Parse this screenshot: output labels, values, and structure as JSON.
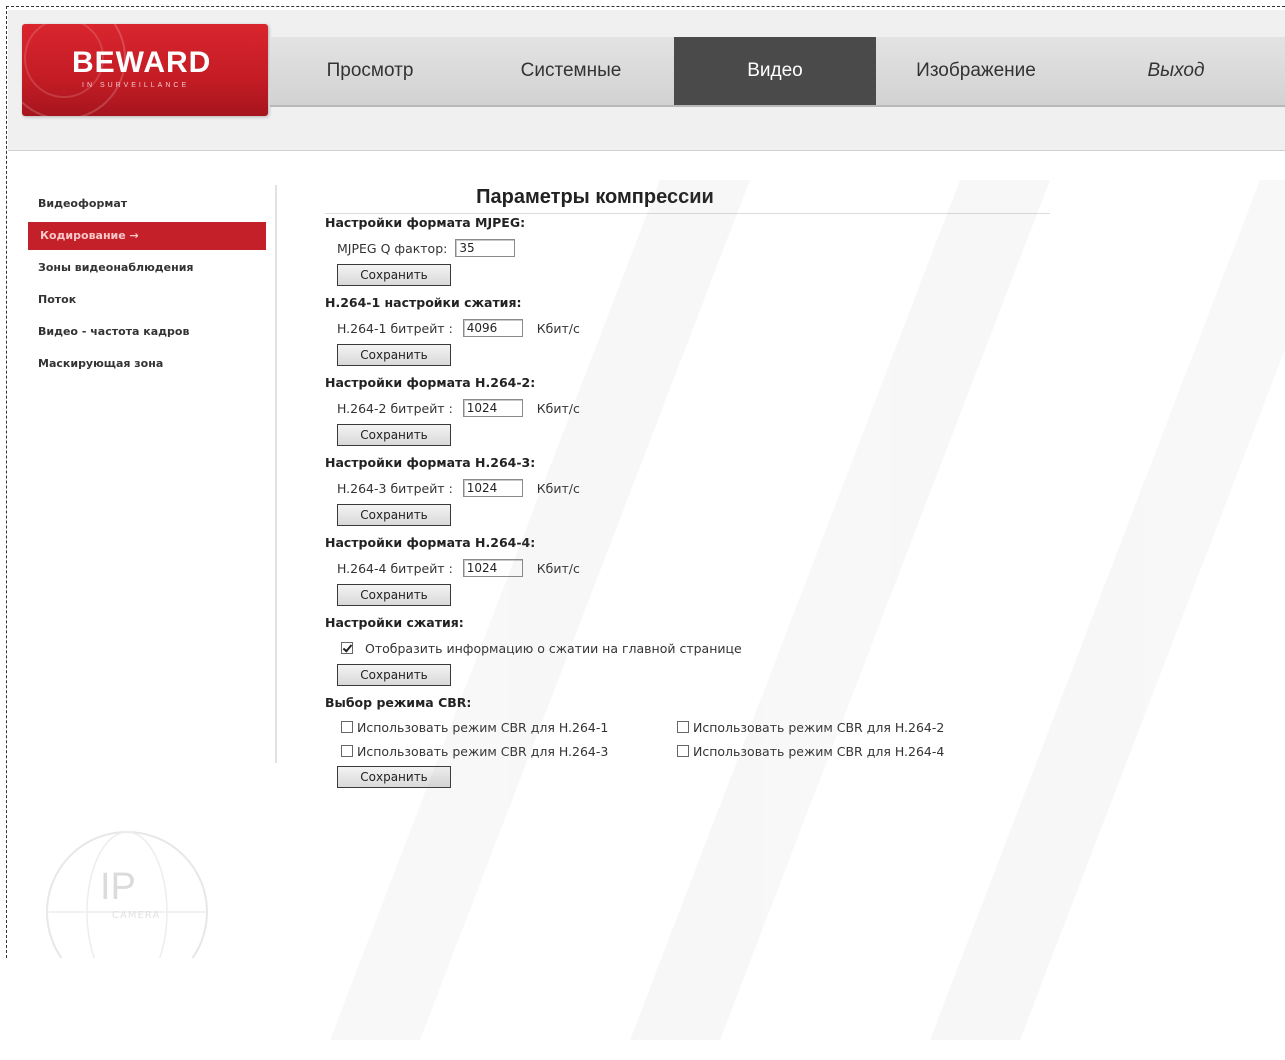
{
  "logo": {
    "text": "BEWARD",
    "subtitle": "IN SURVEILLANCE"
  },
  "nav": {
    "items": [
      {
        "label": "Просмотр"
      },
      {
        "label": "Системные"
      },
      {
        "label": "Видео"
      },
      {
        "label": "Изображение"
      },
      {
        "label": "Выход"
      }
    ],
    "active": "Видео"
  },
  "sidebar": {
    "items": [
      {
        "label": "Видеоформат"
      },
      {
        "label": "Кодирование →"
      },
      {
        "label": "Зоны видеонаблюдения"
      },
      {
        "label": "Поток"
      },
      {
        "label": "Видео - частота кадров"
      },
      {
        "label": "Маскирующая зона"
      }
    ],
    "active": "Кодирование →"
  },
  "main": {
    "title": "Параметры компрессии",
    "mjpeg": {
      "heading": "Настройки формата MJPEG:",
      "label": "MJPEG Q фактор:",
      "value": "35",
      "save": "Сохранить"
    },
    "h264_1": {
      "heading": "H.264-1 настройки сжатия:",
      "label": "H.264-1 битрейт :",
      "value": "4096",
      "unit": "Кбит/с",
      "save": "Сохранить"
    },
    "h264_2": {
      "heading": "Настройки формата H.264-2:",
      "label": "H.264-2 битрейт :",
      "value": "1024",
      "unit": "Кбит/с",
      "save": "Сохранить"
    },
    "h264_3": {
      "heading": "Настройки формата H.264-3:",
      "label": "H.264-3 битрейт :",
      "value": "1024",
      "unit": "Кбит/с",
      "save": "Сохранить"
    },
    "h264_4": {
      "heading": "Настройки формата H.264-4:",
      "label": "H.264-4 битрейт :",
      "value": "1024",
      "unit": "Кбит/с",
      "save": "Сохранить"
    },
    "compression": {
      "heading": "Настройки сжатия:",
      "checkbox_label": "Отобразить информацию о сжатии на главной странице",
      "checked": true,
      "save": "Сохранить"
    },
    "cbr": {
      "heading": "Выбор режима CBR:",
      "options": [
        {
          "label": "Использовать режим CBR для H.264-1",
          "checked": false
        },
        {
          "label": "Использовать режим CBR для H.264-2",
          "checked": false
        },
        {
          "label": "Использовать режим CBR для H.264-3",
          "checked": false
        },
        {
          "label": "Использовать режим CBR для H.264-4",
          "checked": false
        }
      ],
      "save": "Сохранить"
    }
  },
  "watermark": {
    "text": "BEWARD"
  },
  "ipcam": {
    "text": "IP",
    "sub": "CAMERA"
  },
  "colors": {
    "accent": "#c4202a",
    "nav_active": "#4a4a4a",
    "header_bg": "#f0f0f0"
  }
}
